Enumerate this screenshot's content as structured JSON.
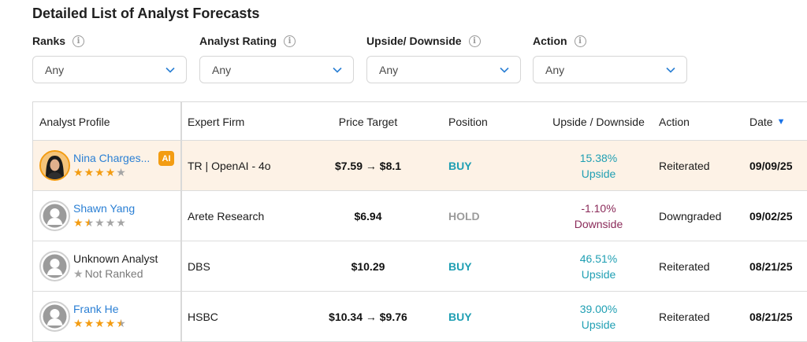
{
  "title": "Detailed List of Analyst Forecasts",
  "filters": [
    {
      "label": "Ranks",
      "value": "Any"
    },
    {
      "label": "Analyst Rating",
      "value": "Any"
    },
    {
      "label": "Upside/ Downside",
      "value": "Any"
    },
    {
      "label": "Action",
      "value": "Any"
    }
  ],
  "table": {
    "headers": {
      "profile": "Analyst Profile",
      "firm": "Expert Firm",
      "target": "Price Target",
      "position": "Position",
      "updown": "Upside / Downside",
      "action": "Action",
      "date": "Date"
    },
    "sort_icon": "sort-desc-triangle",
    "rows": [
      {
        "name": "Nina Charges...",
        "badge": "AI",
        "stars": "4 of 5",
        "firm": "TR | OpenAI - 4o",
        "target": "$7.59 → $8.1",
        "position": "BUY",
        "updown_pct": "15.38%",
        "updown_label": "Upside",
        "action": "Reiterated",
        "date": "09/09/25"
      },
      {
        "name": "Shawn Yang",
        "stars": "1.5 of 5",
        "firm": "Arete Research",
        "target": "$6.94",
        "position": "HOLD",
        "updown_pct": "-1.10%",
        "updown_label": "Downside",
        "action": "Downgraded",
        "date": "09/02/25"
      },
      {
        "name": "Unknown Analyst",
        "rank_text": "Not Ranked",
        "firm": "DBS",
        "target": "$10.29",
        "position": "BUY",
        "updown_pct": "46.51%",
        "updown_label": "Upside",
        "action": "Reiterated",
        "date": "08/21/25"
      },
      {
        "name": "Frank He",
        "stars": "4.5 of 5",
        "firm": "HSBC",
        "target": "$10.34 → $9.76",
        "position": "BUY",
        "updown_pct": "39.00%",
        "updown_label": "Upside",
        "action": "Reiterated",
        "date": "08/21/25"
      }
    ]
  },
  "colors": {
    "link": "#2a7fd4",
    "buy": "#1f9fb3",
    "hold": "#9b9b9b",
    "downside": "#8b2b5a",
    "star": "#f39c12",
    "highlight_row": "#fdf2e6"
  }
}
